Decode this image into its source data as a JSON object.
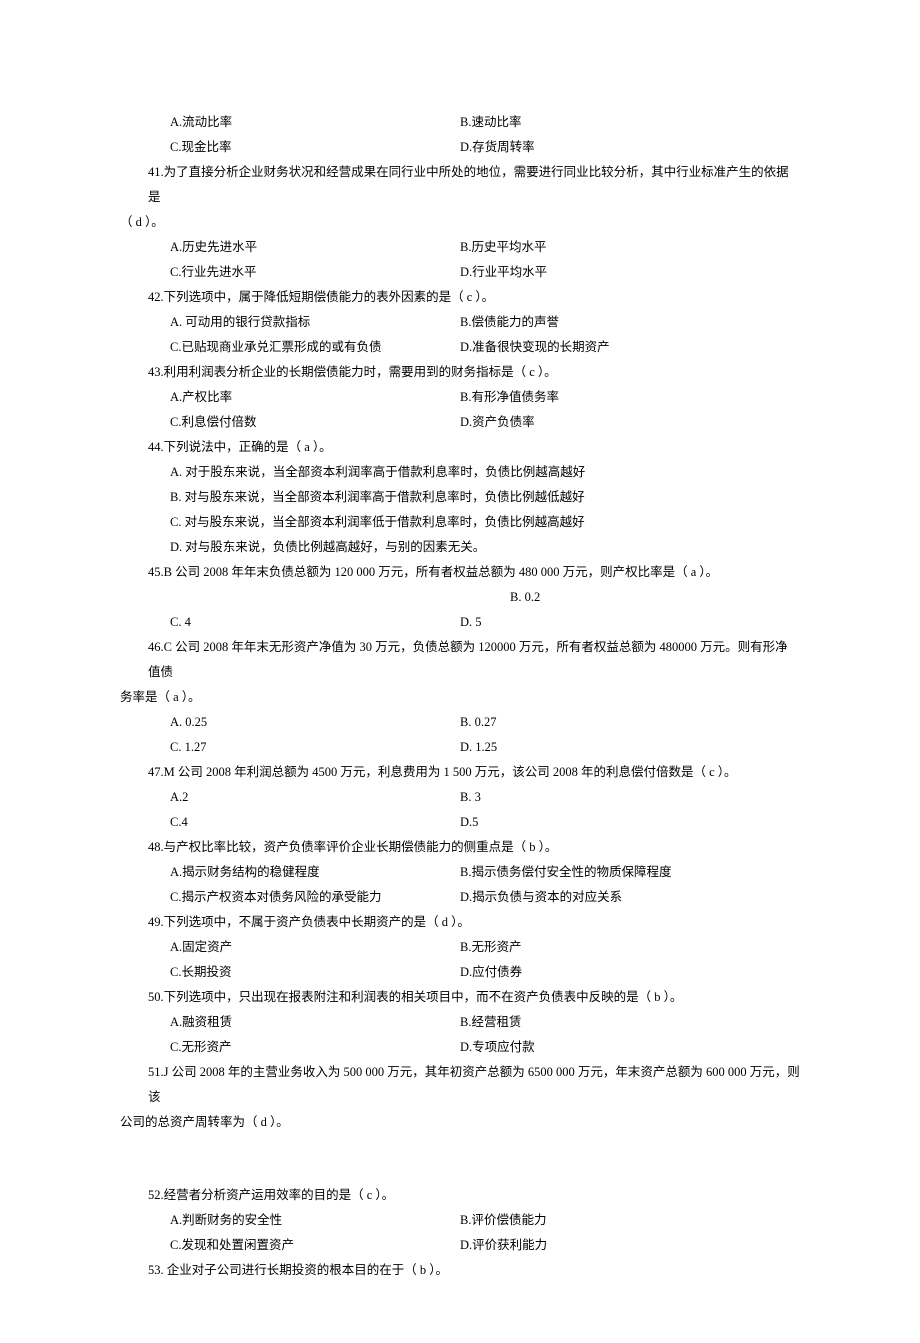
{
  "q40opts": {
    "a": "A.流动比率",
    "b": "B.速动比率",
    "c": "C.现金比率",
    "d": "D.存货周转率"
  },
  "q41": {
    "stem1": "41.为了直接分析企业财务状况和经营成果在同行业中所处的地位，需要进行同业比较分析，其中行业标准产生的依据是",
    "stem2": "（  d  ）。",
    "a": "A.历史先进水平",
    "b": "B.历史平均水平",
    "c": "C.行业先进水平",
    "d": "D.行业平均水平"
  },
  "q42": {
    "stem": "42.下列选项中，属于降低短期偿债能力的表外因素的是（  c  ）。",
    "a": "A. 可动用的银行贷款指标",
    "b": "B.偿债能力的声誉",
    "c": "C.已贴现商业承兑汇票形成的或有负债",
    "d": "D.准备很快变现的长期资产"
  },
  "q43": {
    "stem": "43.利用利润表分析企业的长期偿债能力时，需要用到的财务指标是（  c  ）。",
    "a": "A.产权比率",
    "b": "B.有形净值债务率",
    "c": "C.利息偿付倍数",
    "d": "D.资产负债率"
  },
  "q44": {
    "stem": "44.下列说法中，正确的是（  a  ）。",
    "a": "A. 对于股东来说，当全部资本利润率高于借款利息率时，负债比例越高越好",
    "b": "B. 对与股东来说，当全部资本利润率高于借款利息率时，负债比例越低越好",
    "c": "C. 对与股东来说，当全部资本利润率低于借款利息率时，负债比例越高越好",
    "d": "D. 对与股东来说，负债比例越高越好，与别的因素无关。"
  },
  "q45": {
    "stem": "45.B 公司 2008 年年末负债总额为 120 000 万元，所有者权益总额为 480 000 万元，则产权比率是（  a  ）。",
    "b": "B. 0.2",
    "c": "C. 4",
    "d": "D. 5"
  },
  "q46": {
    "stem1": "46.C 公司 2008 年年末无形资产净值为 30 万元，负债总额为 120000 万元，所有者权益总额为 480000 万元。则有形净值债",
    "stem2": "务率是（  a  ）。",
    "a": "A. 0.25",
    "b": "B. 0.27",
    "c": "C. 1.27",
    "d": "D. 1.25"
  },
  "q47": {
    "stem": "47.M 公司 2008 年利润总额为 4500 万元，利息费用为 1 500 万元，该公司 2008 年的利息偿付倍数是（  c  ）。",
    "a": "A.2",
    "b": "B. 3",
    "c": "C.4",
    "d": "D.5"
  },
  "q48": {
    "stem": "48.与产权比率比较，资产负债率评价企业长期偿债能力的侧重点是（  b  ）。",
    "a": "A.揭示财务结构的稳健程度",
    "b": "B.揭示债务偿付安全性的物质保障程度",
    "c": "C.揭示产权资本对债务风险的承受能力",
    "d": "D.揭示负债与资本的对应关系"
  },
  "q49": {
    "stem": "49.下列选项中，不属于资产负债表中长期资产的是（  d  ）。",
    "a": "A.固定资产",
    "b": "B.无形资产",
    "c": "C.长期投资",
    "d": "D.应付债券"
  },
  "q50": {
    "stem": "50.下列选项中，只出现在报表附注和利润表的相关项目中，而不在资产负债表中反映的是（  b  ）。",
    "a": "A.融资租赁",
    "b": "B.经营租赁",
    "c": "C.无形资产",
    "d": "D.专项应付款"
  },
  "q51": {
    "stem1": "51.J 公司 2008 年的主营业务收入为 500 000 万元，其年初资产总额为 6500 000 万元，年末资产总额为 600 000 万元，则该",
    "stem2": "公司的总资产周转率为（  d  ）。"
  },
  "q52": {
    "stem": "52.经营者分析资产运用效率的目的是（ c  ）。",
    "a": "A.判断财务的安全性",
    "b": "B.评价偿债能力",
    "c": "C.发现和处置闲置资产",
    "d": "D.评价获利能力"
  },
  "q53": {
    "stem": "53. 企业对子公司进行长期投资的根本目的在于（  b  ）。"
  }
}
